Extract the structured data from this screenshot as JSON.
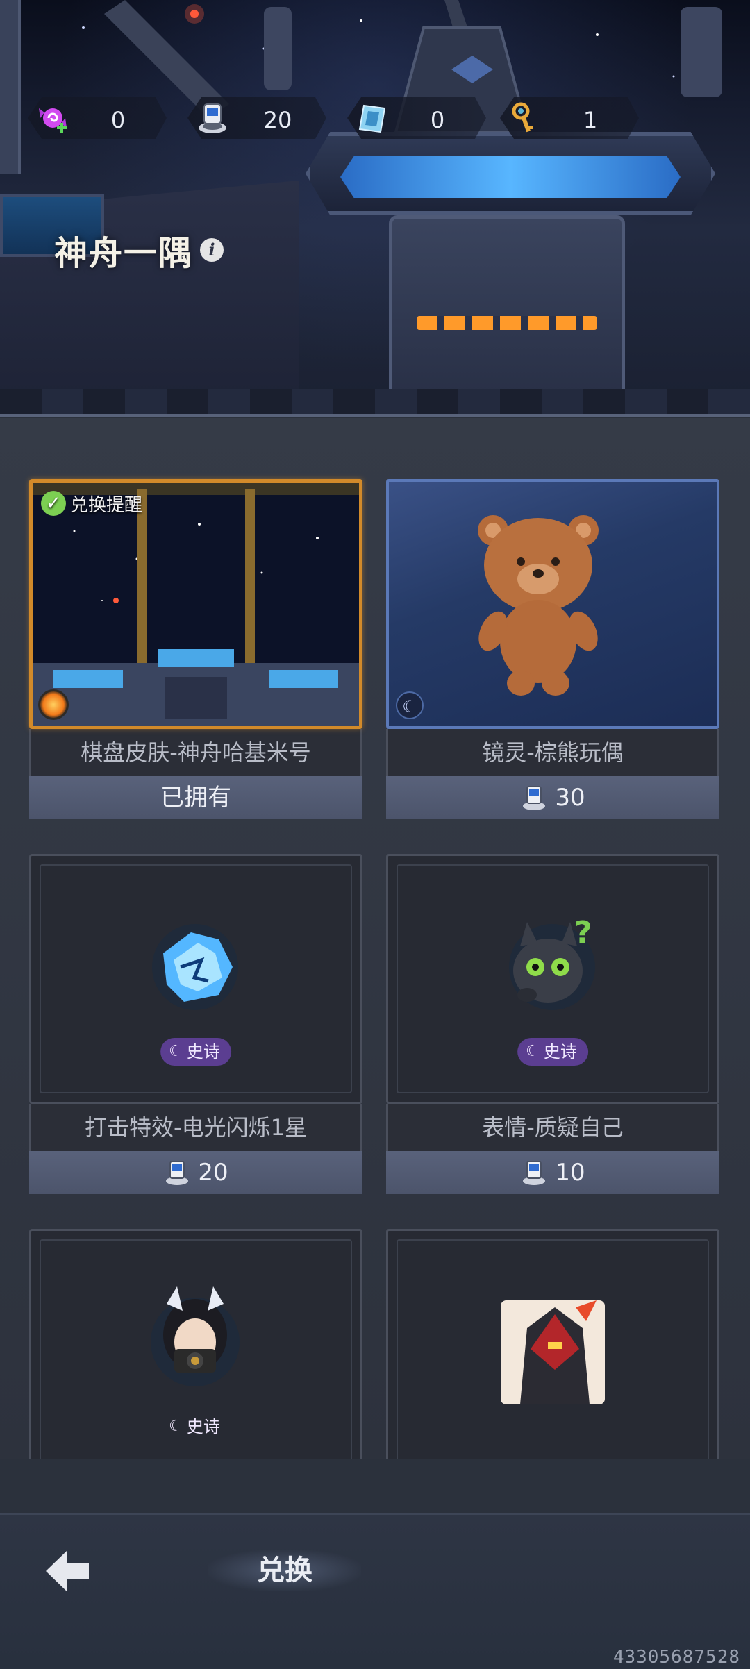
{
  "header": {
    "title": "神舟一隅",
    "info_icon": "info-icon"
  },
  "currencies": [
    {
      "name": "candy-currency",
      "icon": "candy-plus-icon",
      "amount": "0"
    },
    {
      "name": "robot-token-currency",
      "icon": "robot-token-icon",
      "amount": "20"
    },
    {
      "name": "card-currency",
      "icon": "crystal-card-icon",
      "amount": "0"
    },
    {
      "name": "key-currency",
      "icon": "golden-key-icon",
      "amount": "1"
    }
  ],
  "items": [
    {
      "name": "棋盘皮肤-神舟哈基米号",
      "price": "已拥有",
      "badge": "兑换提醒",
      "state": "owned"
    },
    {
      "name": "镜灵-棕熊玩偶",
      "price": "30"
    },
    {
      "name": "打击特效-电光闪烁1星",
      "price": "20",
      "rarity": "史诗"
    },
    {
      "name": "表情-质疑自己",
      "price": "10",
      "rarity": "史诗"
    },
    {
      "name": "",
      "price": "",
      "rarity": "史诗"
    },
    {
      "name": "",
      "price": ""
    }
  ],
  "nav": {
    "back_icon": "back-arrow-icon",
    "exchange_label": "兑换"
  },
  "footer": {
    "device_id": "43305687528"
  },
  "colors": {
    "accent_gold": "#d28a2a",
    "epic_purple": "#5b3e91",
    "price_bar": "#59627b"
  }
}
